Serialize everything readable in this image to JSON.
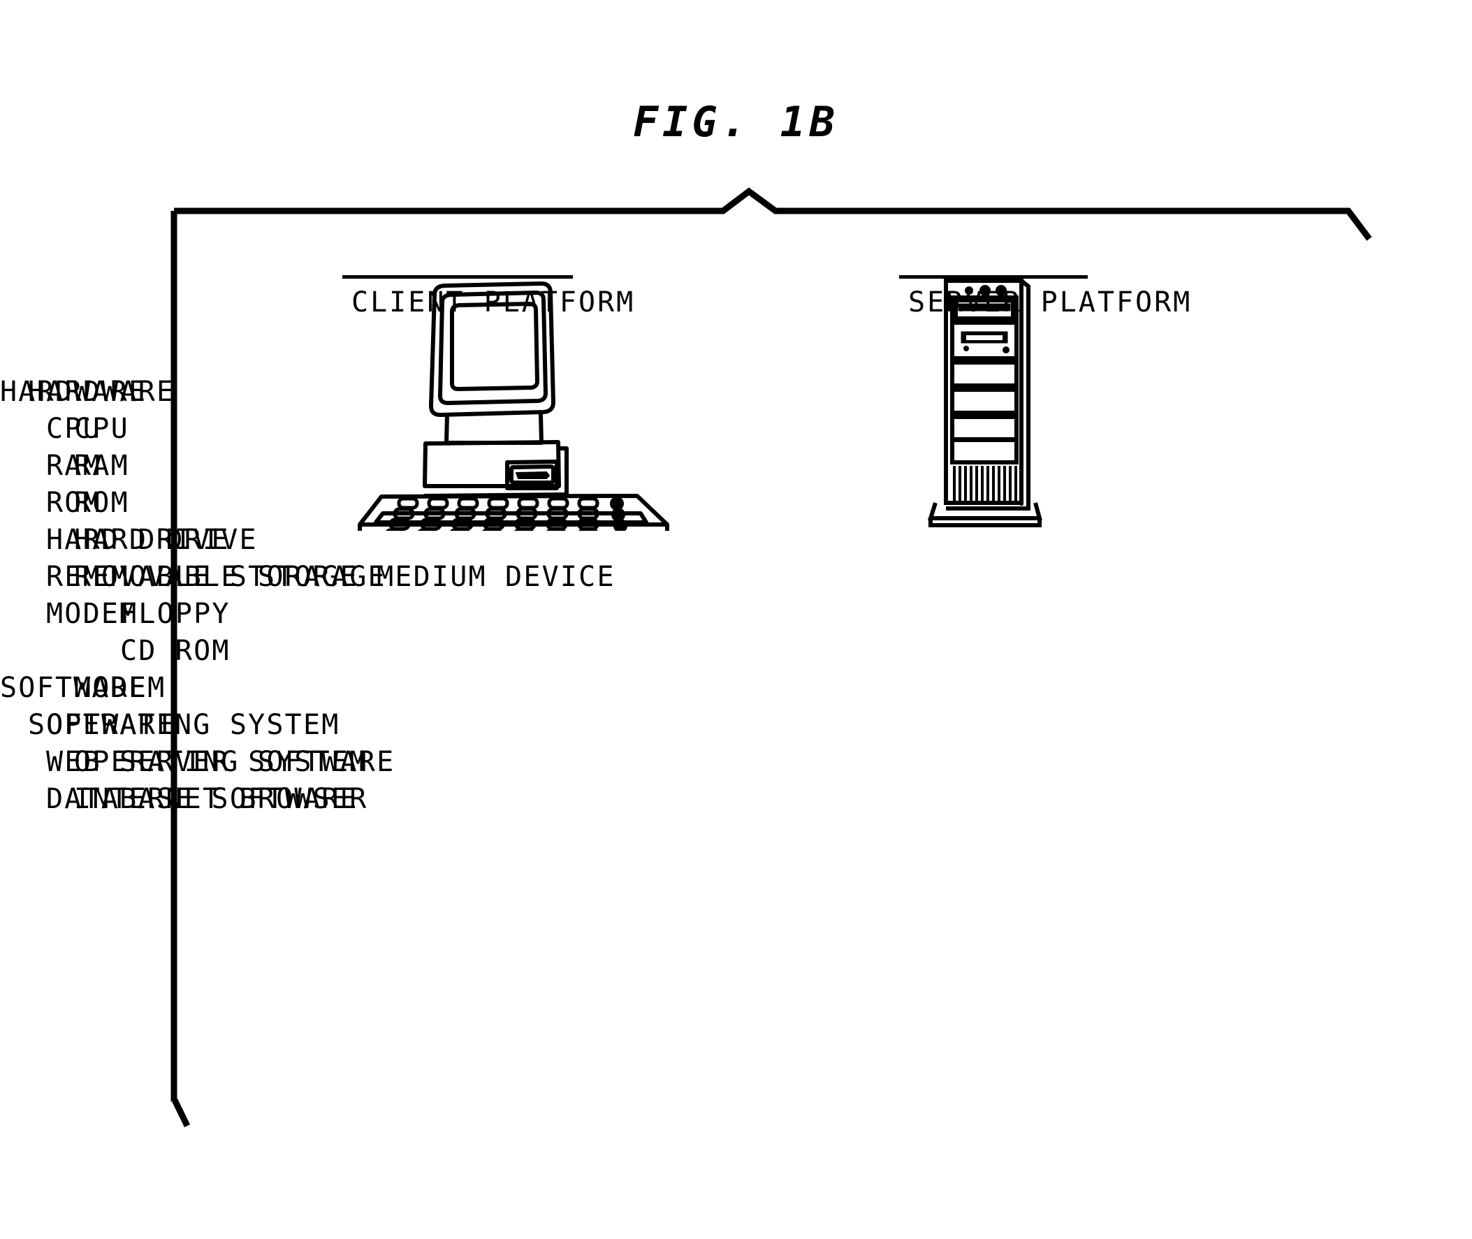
{
  "figure": {
    "title": "FIG. 1B"
  },
  "client": {
    "device_icon": "desktop-computer-icon",
    "label": "CLIENT PLATFORM",
    "lines": [
      {
        "text": "HARDWARE",
        "indent": 0
      },
      {
        "text": "CPU",
        "indent": 1
      },
      {
        "text": "RAM",
        "indent": 1
      },
      {
        "text": "ROM",
        "indent": 1
      },
      {
        "text": "HARD DRIVE",
        "indent": 1
      },
      {
        "text": "REMOVABLE STORAGE",
        "indent": 1
      },
      {
        "text": "FLOPPY",
        "indent": 2
      },
      {
        "text": "CD ROM",
        "indent": 2
      },
      {
        "text": "MODEM",
        "indent": 1
      },
      {
        "text": "SOFTWARE",
        "indent": 0
      },
      {
        "text": "OPERATING SYSTEM",
        "indent": 1
      },
      {
        "text": "INTERNET BROWSER",
        "indent": 1
      }
    ]
  },
  "server": {
    "device_icon": "tower-server-icon",
    "label": "SERVER PLATFORM",
    "lines": [
      {
        "text": "HARDWARE",
        "indent": 0
      },
      {
        "text": "CPU",
        "indent": 1
      },
      {
        "text": "RAM",
        "indent": 1
      },
      {
        "text": "ROM",
        "indent": 1
      },
      {
        "text": "HARD DRIVE",
        "indent": 1
      },
      {
        "text": "REMOVABLE STORAGE MEDIUM DEVICE",
        "indent": 1
      },
      {
        "text": "MODEM",
        "indent": 1
      },
      {
        "text": " ",
        "indent": 0
      },
      {
        "text": "SOFTWARE",
        "indent": 0
      },
      {
        "text": "OPERATING SYSTEM",
        "indent": 1
      },
      {
        "text": "WEB SERVER SOFTWARE",
        "indent": 1
      },
      {
        "text": "DATABASE SOFTWARE",
        "indent": 1
      }
    ]
  },
  "colors": {
    "ink": "#000000",
    "paper": "#ffffff"
  }
}
